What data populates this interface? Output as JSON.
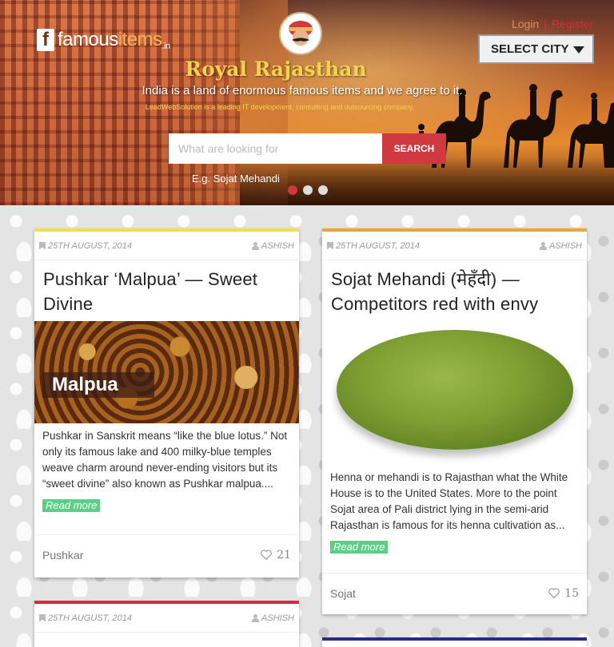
{
  "brand": {
    "logo_letter": "f",
    "name_plain": "famous",
    "name_highlight": "items",
    "tld": ".in"
  },
  "auth": {
    "login": "Login",
    "separator": "|",
    "register": "Register"
  },
  "city_select": {
    "label": "SELECT CITY"
  },
  "hero": {
    "title": "Royal  Rajasthan",
    "subtitle": "India is a land of enormous famous items and we agree to it.",
    "tagline": "LeadWebSolution is a leading IT development, consulting and outsourcing company.",
    "search_placeholder": "What are looking for",
    "search_button": "SEARCH",
    "example": "E.g. Sojat Mehandi",
    "slides": 3,
    "active_slide": 1
  },
  "colors": {
    "accent_red": "#d0393f",
    "read_more_green": "#5cce86",
    "title_gold": "#f5d24a"
  },
  "cards": [
    {
      "date": "25TH AUGUST, 2014",
      "author": "ASHISH",
      "title": "Pushkar ‘Malpua’ — Sweet Divine",
      "image_caption": "Malpua",
      "excerpt": "Pushkar in Sanskrit means “like the blue lotus.” Not only its famous lake and 400 milky-blue temples weave charm around never-ending visitors but its “sweet divine” also known as Pushkar malpua....",
      "read_more": "Read more",
      "location": "Pushkar",
      "likes": "21",
      "accent": "#f0e04a"
    },
    {
      "date": "25TH AUGUST, 2014",
      "author": "ASHISH",
      "title": "Sojat Mehandi (मेहँदी) — Competitors red with envy",
      "excerpt": "Henna or mehandi is to Rajasthan what the White House is to the United States. More to the point Sojat area of Pali district lying in the semi-arid Rajasthan is famous for its henna cultivation as...",
      "read_more": "Read more",
      "location": "Sojat",
      "likes": "15",
      "accent": "#f0a33a"
    },
    {
      "date": "25TH AUGUST, 2014",
      "author": "ASHISH",
      "accent": "#d62b3a"
    },
    {
      "accent": "#2a2a8a"
    }
  ]
}
